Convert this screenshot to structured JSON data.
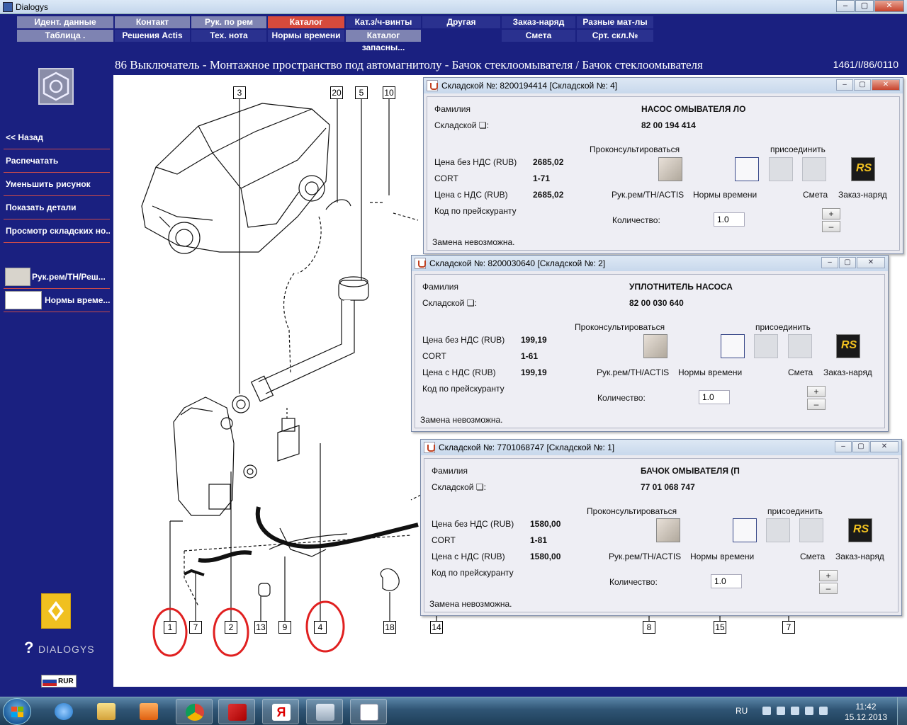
{
  "window": {
    "title": "Dialogys",
    "min": "‒",
    "max": "▢",
    "close": "✕"
  },
  "menu": {
    "row1": [
      "Идент. данные",
      "Контакт",
      "Рук. по рем",
      "Каталог запчастей",
      "Кат.з/ч-винты",
      "Другая",
      "Заказ-наряд",
      "Разные мат-лы"
    ],
    "row2": [
      "Таблица .",
      "Решения Actis",
      "Тех. нота",
      "Нормы времени",
      "Каталог запасны...",
      "",
      "Смета",
      "Срт. скл.№"
    ],
    "active": "Каталог запчастей"
  },
  "breadcrumb": "86 Выключатель - Монтажное пространство под автомагнитолу - Бачок стеклоомывателя / Бачок стеклоомывателя",
  "diagram_code": "1461/I/86/0110",
  "sidebar": {
    "items": [
      "<< Назад",
      "Распечатать",
      "Уменьшить рисунок",
      "Показать детали",
      "Просмотр складских но..."
    ],
    "icon_items": [
      "Рук.рем/TH/Реш...",
      "Нормы време..."
    ],
    "brand": "DIALOGYS",
    "currency": "RUR"
  },
  "diagram": {
    "top_labels": [
      "3",
      "20",
      "5",
      "10"
    ],
    "bottom_labels": [
      "1",
      "7",
      "2",
      "13",
      "9",
      "4",
      "18",
      "14",
      "8",
      "15",
      "7"
    ],
    "circled": [
      "1",
      "2",
      "4"
    ]
  },
  "popups": [
    {
      "title": "Складской №: 8200194414 [Складской №: 4]",
      "family_label": "Фамилия",
      "family": "НАСОС ОМЫВАТЕЛЯ ЛО",
      "sku_label": "Складской ❏:",
      "sku": "82 00 194 414",
      "consult_label": "Проконсультироваться",
      "attach_label": "присоединить",
      "price_nett_label": "Цена без НДС (RUB)",
      "price_nett": "2685,02",
      "cort_label": "CORT",
      "cort": "1-71",
      "price_vat_label": "Цена с НДС (RUB)",
      "price_vat": "2685,02",
      "pricelist_label": "Код по прейскуранту",
      "btn_rk": "Рук.рем/TH/ACTIS",
      "btn_nv": "Нормы времени",
      "btn_sm": "Смета",
      "btn_zn": "Заказ-наряд",
      "qty_label": "Количество:",
      "qty": "1.0",
      "replace": "Замена невозможна."
    },
    {
      "title": "Складской №: 8200030640 [Складской №: 2]",
      "family_label": "Фамилия",
      "family": "УПЛОТНИТЕЛЬ НАСОСА",
      "sku_label": "Складской ❏:",
      "sku": "82 00 030 640",
      "consult_label": "Проконсультироваться",
      "attach_label": "присоединить",
      "price_nett_label": "Цена без НДС (RUB)",
      "price_nett": "199,19",
      "cort_label": "CORT",
      "cort": "1-61",
      "price_vat_label": "Цена с НДС (RUB)",
      "price_vat": "199,19",
      "pricelist_label": "Код по прейскуранту",
      "btn_rk": "Рук.рем/TH/ACTIS",
      "btn_nv": "Нормы времени",
      "btn_sm": "Смета",
      "btn_zn": "Заказ-наряд",
      "qty_label": "Количество:",
      "qty": "1.0",
      "replace": "Замена невозможна."
    },
    {
      "title": "Складской №: 7701068747 [Складской №: 1]",
      "family_label": "Фамилия",
      "family": "БАЧОК ОМЫВАТЕЛЯ (П",
      "sku_label": "Складской ❏:",
      "sku": "77 01 068 747",
      "consult_label": "Проконсультироваться",
      "attach_label": "присоединить",
      "price_nett_label": "Цена без НДС (RUB)",
      "price_nett": "1580,00",
      "cort_label": "CORT",
      "cort": "1-81",
      "price_vat_label": "Цена с НДС (RUB)",
      "price_vat": "1580,00",
      "pricelist_label": "Код по прейскуранту",
      "btn_rk": "Рук.рем/TH/ACTIS",
      "btn_nv": "Нормы времени",
      "btn_sm": "Смета",
      "btn_zn": "Заказ-наряд",
      "qty_label": "Количество:",
      "qty": "1.0",
      "replace": "Замена невозможна."
    }
  ],
  "taskbar": {
    "apps": [
      "start-orb",
      "internet-explorer",
      "file-explorer",
      "media-player",
      "chrome",
      "kaspersky",
      "yandex",
      "speaker",
      "java"
    ],
    "lang": "RU",
    "time": "11:42",
    "date": "15.12.2013"
  },
  "colors": {
    "background": "#1a2080",
    "menu_active": "#d74a3c",
    "menu_grey": "#7e83b2",
    "circle_mark": "#e02020"
  }
}
